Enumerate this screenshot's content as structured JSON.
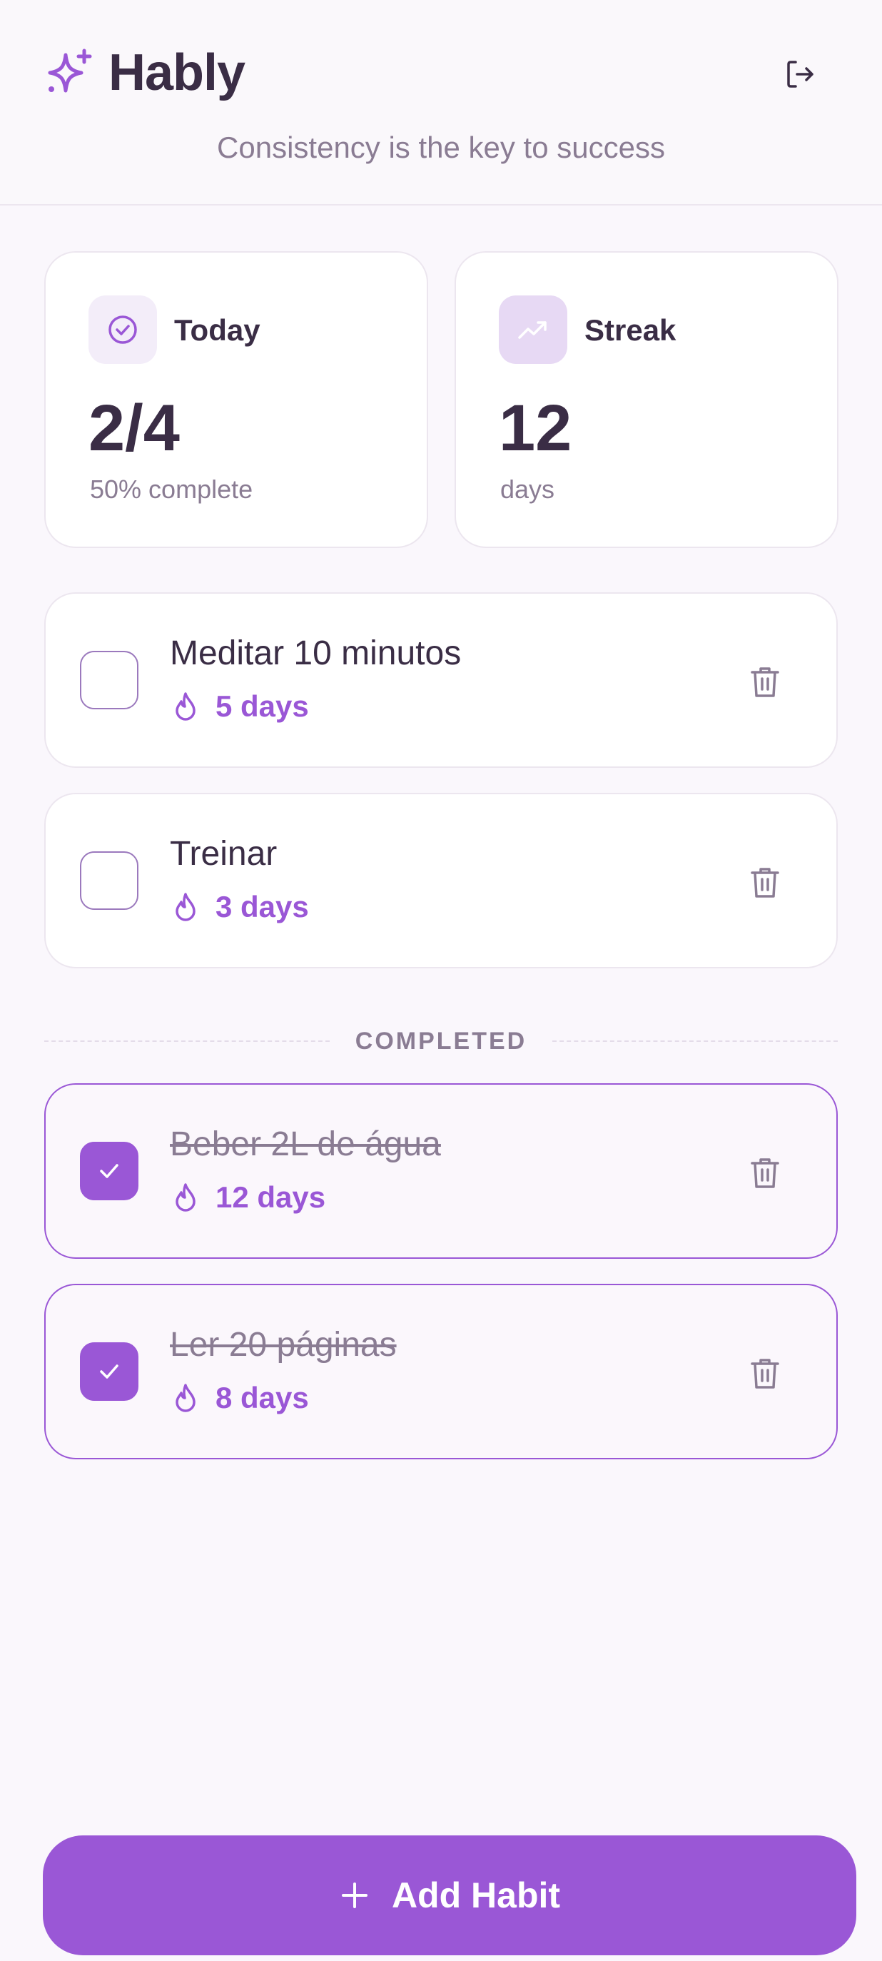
{
  "app": {
    "title": "Hably",
    "tagline": "Consistency is the key to success"
  },
  "colors": {
    "accent": "#9a57d6",
    "text": "#3a2d45",
    "muted": "#8a7c93",
    "background": "#faf7fc"
  },
  "stats": {
    "today": {
      "label": "Today",
      "value": "2/4",
      "sub": "50% complete",
      "icon": "check-circle-icon"
    },
    "streak": {
      "label": "Streak",
      "value": "12",
      "sub": "days",
      "icon": "trending-up-icon"
    }
  },
  "habits": [
    {
      "name": "Meditar 10 minutos",
      "streak": "5 days",
      "completed": false
    },
    {
      "name": "Treinar",
      "streak": "3 days",
      "completed": false
    },
    {
      "name": "Beber 2L de água",
      "streak": "12 days",
      "completed": true
    },
    {
      "name": "Ler 20 páginas",
      "streak": "8 days",
      "completed": true
    }
  ],
  "completed_section_label": "COMPLETED",
  "add_button_label": "Add Habit"
}
